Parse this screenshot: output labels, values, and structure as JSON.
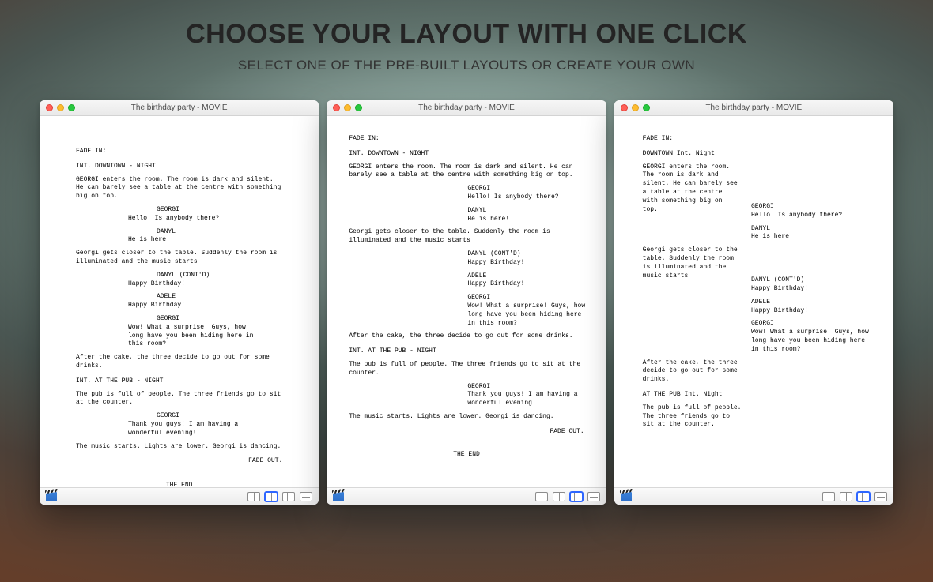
{
  "headline": {
    "title": "CHOOSE YOUR LAYOUT WITH ONE CLICK",
    "subtitle": "SELECT ONE OF THE PRE-BUILT LAYOUTS OR CREATE YOUR OWN"
  },
  "window_title": "The birthday party - MOVIE",
  "script": {
    "fade_in": "FADE IN:",
    "slug1": "INT. DOWNTOWN - NIGHT",
    "slug1_alt": "DOWNTOWN Int. Night",
    "action1": "GEORGI enters the room. The room is dark and silent. He can barely see a table at the centre with something big on top.",
    "char_georgi": "GEORGI",
    "d_georgi1": "Hello! Is anybody there?",
    "char_danyl": "DANYL",
    "d_danyl1": "He is here!",
    "action2": "Georgi gets closer to the table. Suddenly the room is illuminated and the music starts",
    "char_danyl_contd": "DANYL (CONT'D)",
    "d_danyl2": "Happy Birthday!",
    "char_adele": "ADELE",
    "d_adele1": "Happy Birthday!",
    "d_georgi2": "Wow! What a surprise! Guys, how long have you been hiding here in this room?",
    "action3": "After the cake, the three decide to go out for some drinks.",
    "slug2": "INT. AT THE PUB - NIGHT",
    "slug2_alt": "AT THE PUB Int. Night",
    "action4": "The pub is full of people. The three friends go to sit at the counter.",
    "d_georgi3": "Thank you guys! I am having a wonderful evening!",
    "action5": "The music starts. Lights are lower. Georgi is dancing.",
    "fade_out": "FADE OUT.",
    "the_end": "THE END"
  },
  "toolbar": {
    "layout_single": "layout-single",
    "layout_split": "layout-split",
    "layout_wide": "layout-wide",
    "layout_bar": "layout-bar"
  }
}
